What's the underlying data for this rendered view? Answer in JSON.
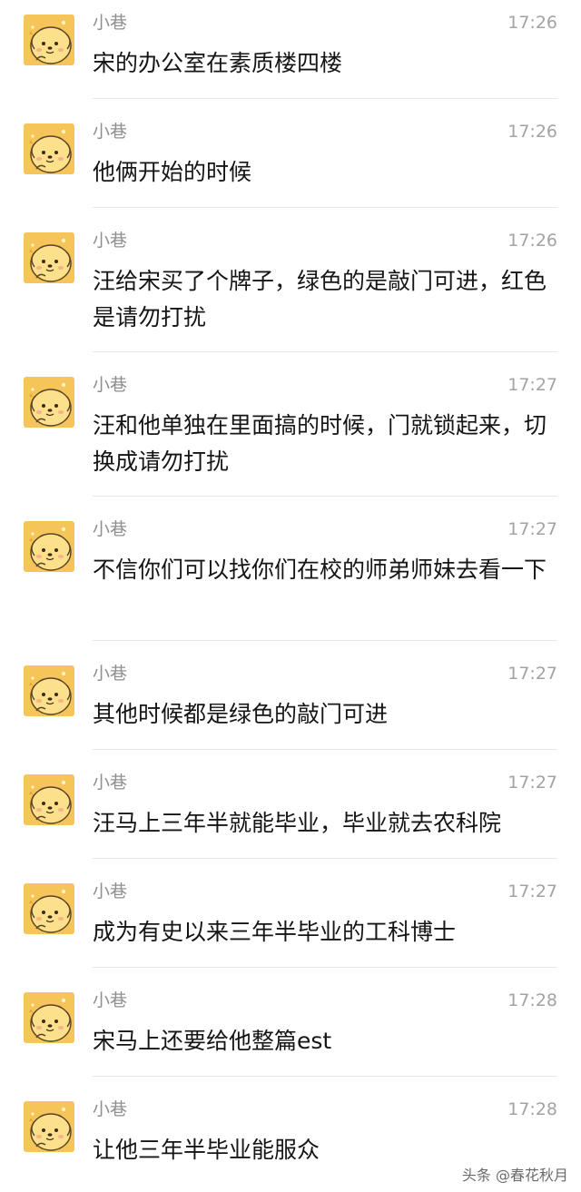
{
  "colors": {
    "avatar_bg": "#f6c55a",
    "avatar_face": "#fde08c",
    "sender": "#8f8f8f",
    "time": "#a3a3a3",
    "divider": "#e8e8e8"
  },
  "messages": [
    {
      "sender": "小巷",
      "time": "17:26",
      "text": "宋的办公室在素质楼四楼",
      "avatar": "cartoon-dog-avatar"
    },
    {
      "sender": "小巷",
      "time": "17:26",
      "text": "他俩开始的时候",
      "avatar": "cartoon-dog-avatar"
    },
    {
      "sender": "小巷",
      "time": "17:26",
      "text": "汪给宋买了个牌子，绿色的是敲门可进，红色是请勿打扰",
      "avatar": "cartoon-dog-avatar"
    },
    {
      "sender": "小巷",
      "time": "17:27",
      "text": "汪和他单独在里面搞的时候，门就锁起来，切换成请勿打扰",
      "avatar": "cartoon-dog-avatar"
    },
    {
      "sender": "小巷",
      "time": "17:27",
      "text": "不信你们可以找你们在校的师弟师妹去看一下",
      "avatar": "cartoon-dog-avatar"
    },
    {
      "sender": "小巷",
      "time": "17:27",
      "text": "其他时候都是绿色的敲门可进",
      "avatar": "cartoon-dog-avatar"
    },
    {
      "sender": "小巷",
      "time": "17:27",
      "text": "汪马上三年半就能毕业，毕业就去农科院",
      "avatar": "cartoon-dog-avatar"
    },
    {
      "sender": "小巷",
      "time": "17:27",
      "text": "成为有史以来三年半毕业的工科博士",
      "avatar": "cartoon-dog-avatar"
    },
    {
      "sender": "小巷",
      "time": "17:28",
      "text": "宋马上还要给他整篇est",
      "avatar": "cartoon-dog-avatar"
    },
    {
      "sender": "小巷",
      "time": "17:28",
      "text": "让他三年半毕业能服众",
      "avatar": "cartoon-dog-avatar"
    }
  ],
  "watermark": "头条 @春花秋月"
}
